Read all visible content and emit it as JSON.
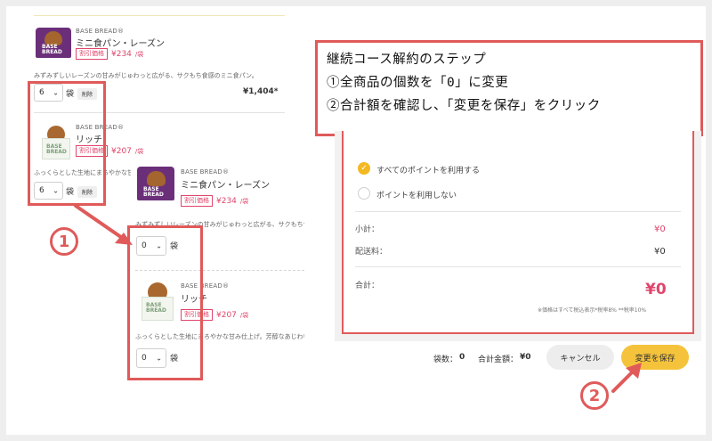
{
  "products": [
    {
      "brand": "BASE BREAD®",
      "name": "ミニ食パン・レーズン",
      "badge": "割引価格",
      "price": "¥234",
      "unit": "/袋",
      "desc": "みずみずしいレーズンの甘みがじゅわっと広がる、サクもち食感のミニ食パン。",
      "qty": "6",
      "qty_unit": "袋",
      "delete_label": "削除",
      "total": "¥1,404*",
      "package_label": "BASE BREAD"
    },
    {
      "brand": "BASE BREAD®",
      "name": "リッチ",
      "badge": "割引価格",
      "price": "¥207",
      "unit": "/袋",
      "desc": "ふっくらとした生地にまろやかな甘み",
      "qty": "6",
      "qty_unit": "袋",
      "delete_label": "削除",
      "package_label": "BASE BREAD"
    }
  ],
  "zoom_products": [
    {
      "brand": "BASE BREAD®",
      "name": "ミニ食パン・レーズン",
      "badge": "割引価格",
      "price": "¥234",
      "unit": "/袋",
      "desc": "みずみずしいレーズンの甘みがじゅわっと広がる、サクもち食",
      "qty": "0",
      "qty_unit": "袋",
      "package_label": "BASE BREAD"
    },
    {
      "brand": "BASE BREAD®",
      "name": "リッチ",
      "badge": "割引価格",
      "price": "¥207",
      "unit": "/袋",
      "desc": "ふっくらとした生地にまろやかな甘み仕上げ。芳醇なあじわい",
      "qty": "0",
      "qty_unit": "袋",
      "package_label": "BASE BREAD"
    }
  ],
  "instructions": {
    "title": "継続コース解約のステップ",
    "step1": "①全商品の個数を「0」に変更",
    "step2": "②合計額を確認し、「変更を保存」をクリック"
  },
  "markers": {
    "one": "1",
    "two": "2"
  },
  "points": {
    "use_all": "すべてのポイントを利用する",
    "use_none": "ポイントを利用しない",
    "selected": "use_all"
  },
  "summary": {
    "subtotal_label": "小計：",
    "subtotal": "¥0",
    "shipping_label": "配送料：",
    "shipping": "¥0",
    "total_label": "合計：",
    "total": "¥0",
    "note": "※価格はすべて税込表示*税率8% **税率10%"
  },
  "footer": {
    "bags_label": "袋数：",
    "bags": "0",
    "amount_label": "合計金額：",
    "amount": "¥0",
    "cancel_label": "キャンセル",
    "save_label": "変更を保存"
  },
  "colors": {
    "accent_red": "#e05a5a",
    "price_pink": "#e0456b",
    "save_yellow": "#f5c33b",
    "radio_yellow": "#f4b821"
  }
}
